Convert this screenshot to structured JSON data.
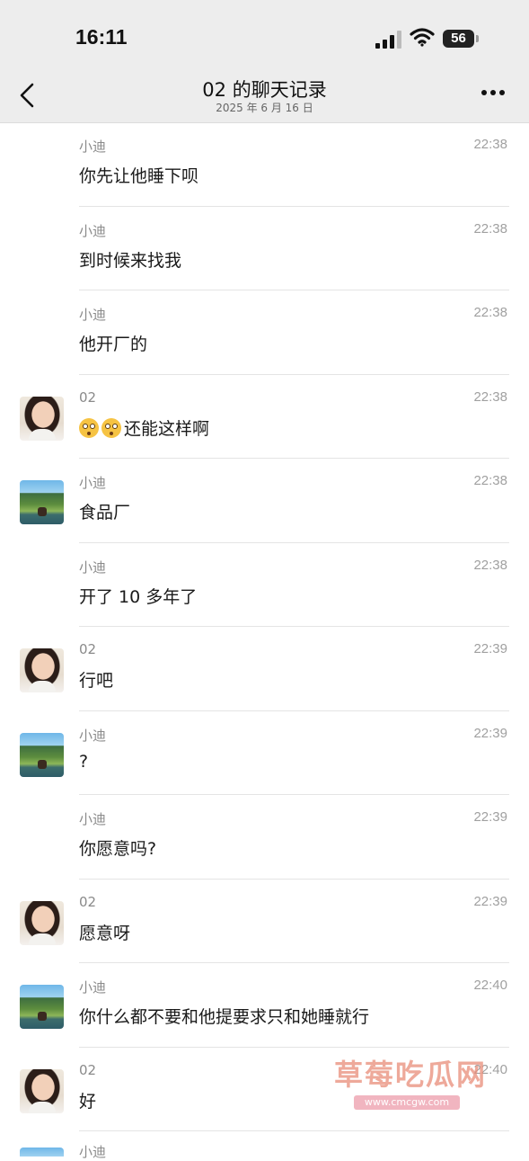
{
  "status_bar": {
    "time": "16:11",
    "battery": "56"
  },
  "header": {
    "title": "02 的聊天记录",
    "date": "2025 年 6 月 16 日"
  },
  "messages": [
    {
      "name": "小迪",
      "time": "22:38",
      "text": "你先让他睡下呗",
      "avatar": "none"
    },
    {
      "name": "小迪",
      "time": "22:38",
      "text": "到时候来找我",
      "avatar": "none"
    },
    {
      "name": "小迪",
      "time": "22:38",
      "text": "他开厂的",
      "avatar": "none"
    },
    {
      "name": "02",
      "time": "22:38",
      "text": "还能这样啊",
      "avatar": "person",
      "emoji_prefix": "flushed-face x2"
    },
    {
      "name": "小迪",
      "time": "22:38",
      "text": "食品厂",
      "avatar": "landscape"
    },
    {
      "name": "小迪",
      "time": "22:38",
      "text": "开了 10 多年了",
      "avatar": "none"
    },
    {
      "name": "02",
      "time": "22:39",
      "text": "行吧",
      "avatar": "person"
    },
    {
      "name": "小迪",
      "time": "22:39",
      "text": "?",
      "avatar": "landscape"
    },
    {
      "name": "小迪",
      "time": "22:39",
      "text": "你愿意吗?",
      "avatar": "none"
    },
    {
      "name": "02",
      "time": "22:39",
      "text": "愿意呀",
      "avatar": "person"
    },
    {
      "name": "小迪",
      "time": "22:40",
      "text": "你什么都不要和他提要求只和她睡就行",
      "avatar": "landscape"
    },
    {
      "name": "02",
      "time": "22:40",
      "text": "好",
      "avatar": "person"
    }
  ],
  "partial_row": {
    "name": "小迪"
  },
  "watermark": {
    "text": "草莓吃瓜网",
    "url": "www.cmcgw.com"
  }
}
